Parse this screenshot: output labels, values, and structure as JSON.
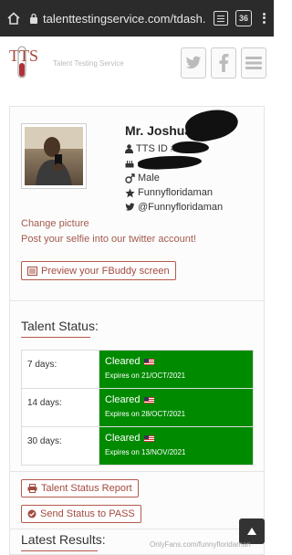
{
  "browser": {
    "url": "talenttestingservice.com/tdash.",
    "tab_count": "36"
  },
  "header": {
    "logo_text": "TTS",
    "tagline": "Talent Testing Service"
  },
  "profile": {
    "name": "Mr. Joshua",
    "tts_id_label": "TTS ID #",
    "gender": "Male",
    "nickname": "Funnyfloridaman",
    "twitter": "@Funnyfloridaman",
    "change_picture": "Change picture",
    "selfie_prompt": "Post your selfie into our twitter account!",
    "preview_button": "Preview your FBuddy screen"
  },
  "talent_status": {
    "title": "Talent Status:",
    "rows": [
      {
        "period": "7 days:",
        "status": "Cleared",
        "expires": "Expires on 21/OCT/2021"
      },
      {
        "period": "14 days:",
        "status": "Cleared",
        "expires": "Expires on 28/OCT/2021"
      },
      {
        "period": "30 days:",
        "status": "Cleared",
        "expires": "Expires on 13/NOV/2021"
      }
    ],
    "cleared_color": "#008a00"
  },
  "actions": {
    "report_button": "Talent Status Report",
    "send_button": "Send Status to PASS"
  },
  "latest": {
    "title": "Latest Results:"
  },
  "watermark": "OnlyFans.com/funnyfloridaman",
  "colors": {
    "accent": "#b55a4e",
    "browser_bar": "#2b2b2b"
  }
}
